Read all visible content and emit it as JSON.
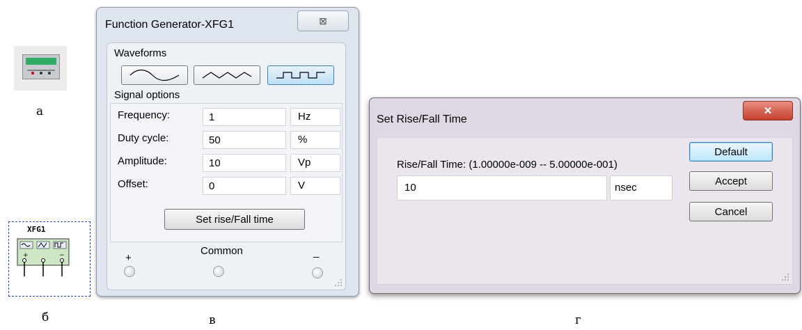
{
  "captions": {
    "a": "а",
    "b": "б",
    "c": "в",
    "d": "г"
  },
  "symbol": {
    "name": "XFG1"
  },
  "function_generator": {
    "title": "Function Generator-XFG1",
    "close_glyph": "⊠",
    "waveforms_label": "Waveforms",
    "waveform_buttons": [
      "sine",
      "triangle",
      "square"
    ],
    "active_waveform": "square",
    "signal_options_label": "Signal options",
    "rows": [
      {
        "label": "Frequency:",
        "value": "1",
        "unit": "Hz"
      },
      {
        "label": "Duty cycle:",
        "value": "50",
        "unit": "%"
      },
      {
        "label": "Amplitude:",
        "value": "10",
        "unit": "Vp"
      },
      {
        "label": "Offset:",
        "value": "0",
        "unit": "V"
      }
    ],
    "set_rise_button": "Set rise/Fall time",
    "terminals": {
      "plus": "+",
      "common": "Common",
      "minus": "_"
    }
  },
  "rise_fall_dialog": {
    "title": "Set Rise/Fall Time",
    "close_glyph": "✕",
    "range_label": "Rise/Fall Time: (1.00000e-009 -- 5.00000e-001)",
    "value": "10",
    "unit": "nsec",
    "buttons": {
      "default": "Default",
      "accept": "Accept",
      "cancel": "Cancel"
    }
  }
}
